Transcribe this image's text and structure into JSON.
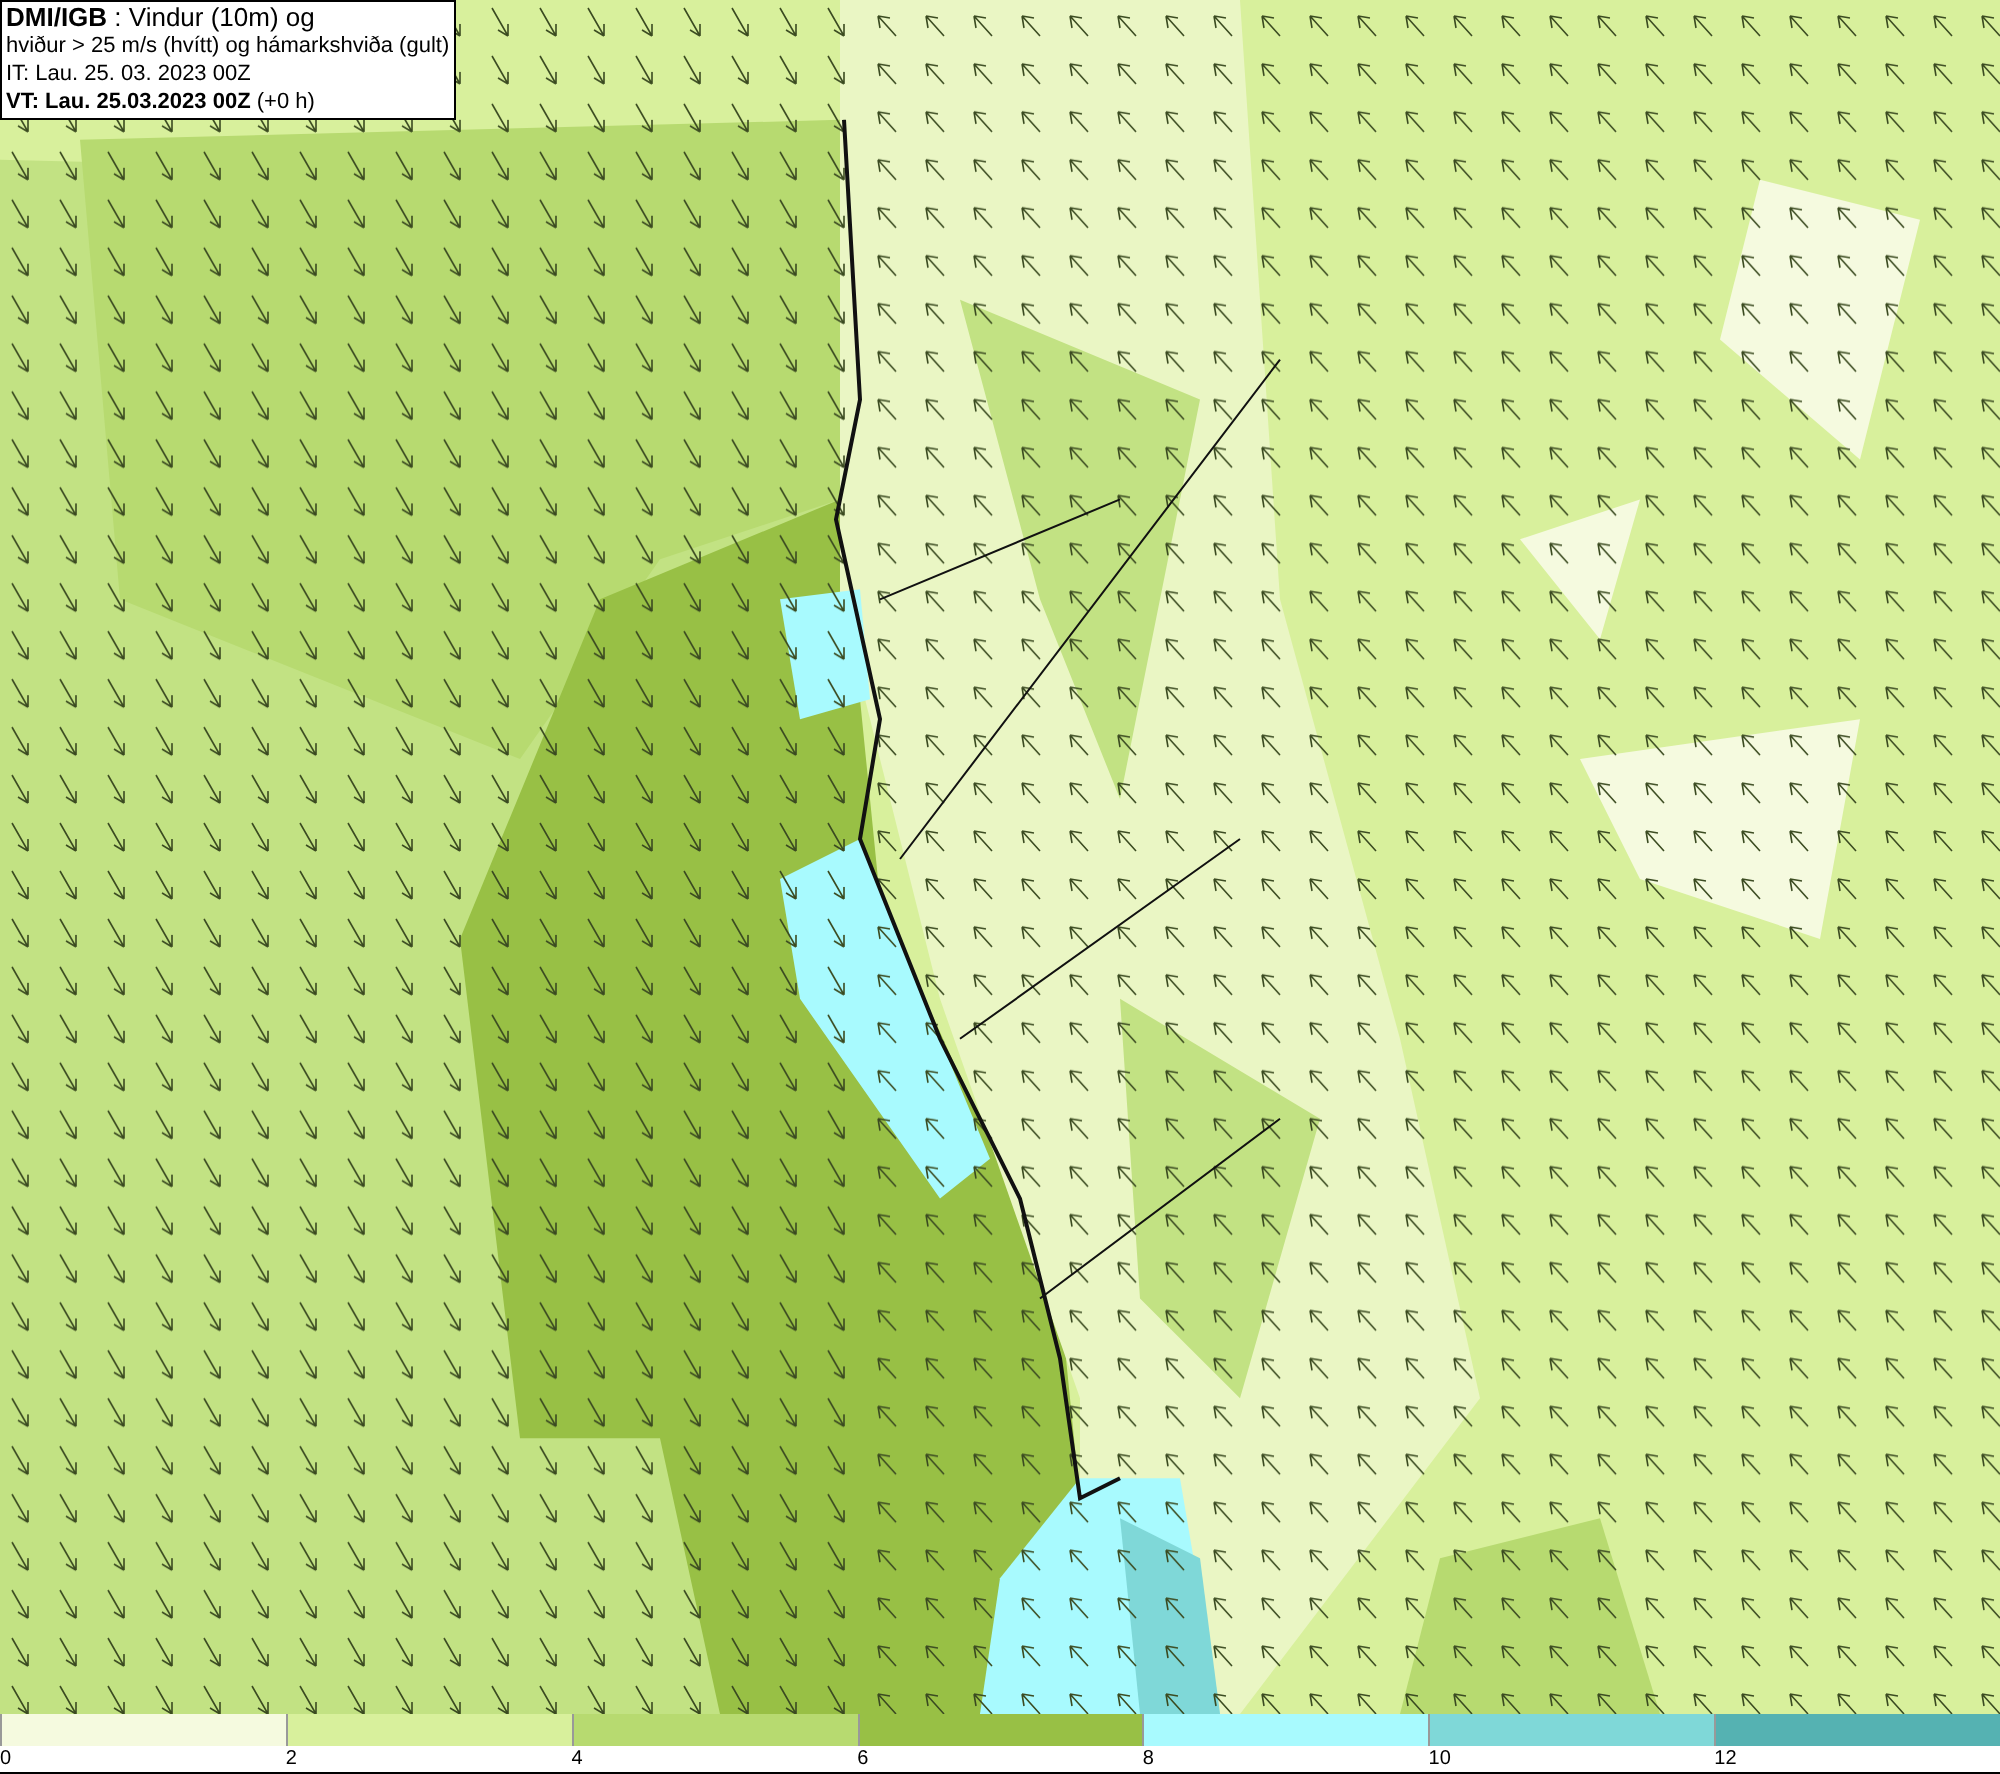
{
  "title_box": {
    "lines": [
      "**DMI/IGB** : Vindur (10m) og",
      "hviður > 25 m/s (hvítt) og hámarkshviða (gult)",
      "IT: Lau. 25. 03. 2023 00Z",
      "**VT: Lau. 25.03.2023 00Z** (+0 h)"
    ]
  },
  "legend": {
    "segments": [
      {
        "color": "#f5fadf",
        "label": "0"
      },
      {
        "color": "#d8f09c",
        "label": "2"
      },
      {
        "color": "#b7da70",
        "label": "4"
      },
      {
        "color": "#98c045",
        "label": "6"
      },
      {
        "color": "#a8fafe",
        "label": "8"
      },
      {
        "color": "#7fd8d8",
        "label": "10"
      },
      {
        "color": "#55b2b2",
        "label": "12"
      }
    ]
  }
}
